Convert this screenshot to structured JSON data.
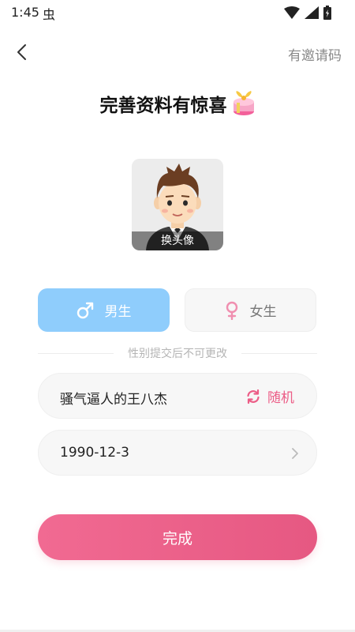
{
  "status_bar": {
    "time": "1:45",
    "extra": "虫"
  },
  "header": {
    "invite_label": "有邀请码"
  },
  "title": "完善资料有惊喜",
  "avatar": {
    "caption": "换头像"
  },
  "gender": {
    "male_label": "男生",
    "female_label": "女生",
    "selected": "male",
    "note": "性别提交后不可更改"
  },
  "nickname": {
    "value": "骚气逼人的王八杰",
    "random_label": "随机"
  },
  "birthday": {
    "value": "1990-12-3"
  },
  "done_label": "完成",
  "icons": {
    "back": "back-arrow-icon",
    "gift": "gift-icon",
    "male": "male-symbol-icon",
    "female": "female-symbol-icon",
    "refresh": "refresh-icon",
    "chevron": "chevron-right-icon"
  },
  "colors": {
    "accent_pink": "#ec5c86",
    "male_selected_bg": "#8fcdfc",
    "button_gradient_start": "#f16a92",
    "button_gradient_end": "#e65882"
  }
}
